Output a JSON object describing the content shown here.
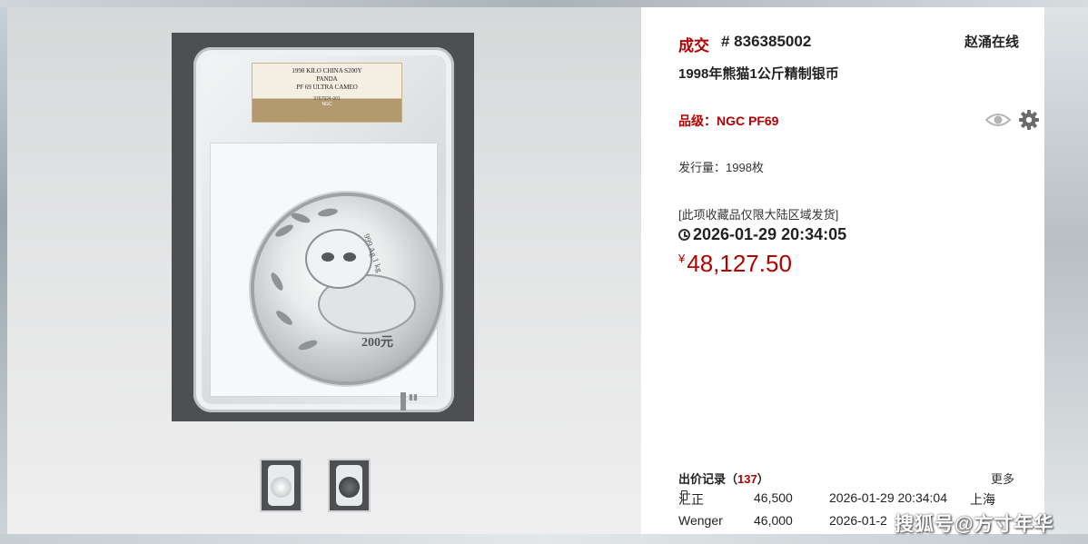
{
  "lot": {
    "status": "成交",
    "number": "# 836385002",
    "auction_house": "赵涌在线",
    "title": "1998年熊猫1公斤精制银币",
    "grade": "品级：NGC PF69",
    "mintage": "发行量：1998枚",
    "shipping_notice": "[此项收藏品仅限大陆区域发货]",
    "end_time": "2026-01-29 20:34:05",
    "currency_symbol": "¥",
    "price": "48,127.50"
  },
  "slab": {
    "line1": "1998 KILO CHINA S200Y",
    "line2": "PANDA",
    "line3": "PF 69 ULTRA CAMEO",
    "cert": "3767924-001",
    "brand": "NGC"
  },
  "coin": {
    "denomination": "200元",
    "weight": "999 Ag 1 kg"
  },
  "bids": {
    "label": "出价记录",
    "count": "137",
    "more_label": "更多",
    "rows": [
      {
        "bidder": "汇正",
        "amount": "46,500",
        "time": "2026-01-29 20:34:04",
        "location": "上海"
      },
      {
        "bidder": "Wenger",
        "amount": "46,000",
        "time": "2026-01-2",
        "location": ""
      }
    ]
  },
  "icons": {
    "watch": "eye-icon",
    "settings": "gear-icon",
    "clock": "clock-icon",
    "device": "phone-icon"
  },
  "colors": {
    "accent_red": "#b30000",
    "text": "#222222"
  },
  "watermark": "搜狐号@方寸年华"
}
